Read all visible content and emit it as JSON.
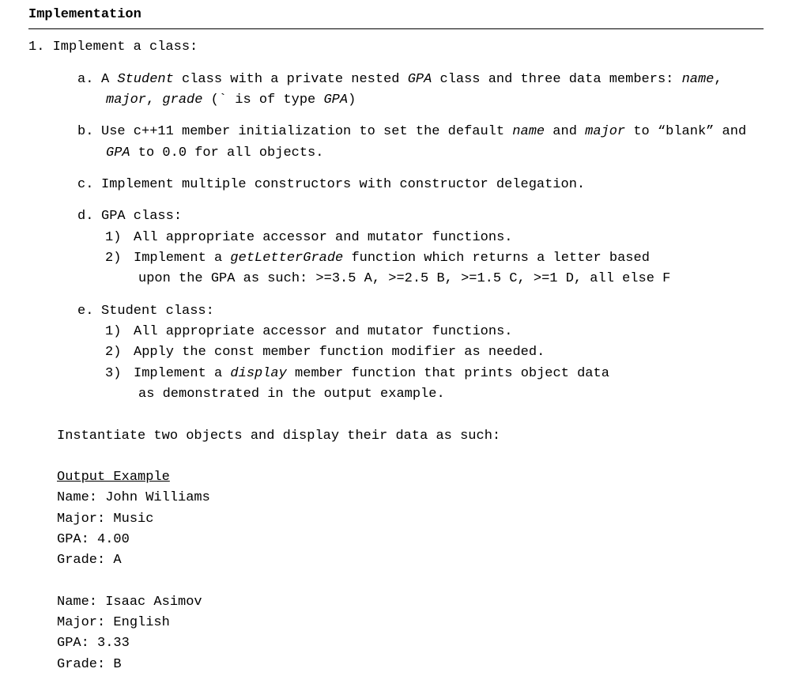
{
  "section_title": "Implementation",
  "main_item": {
    "number": "1.",
    "text": "Implement a class:"
  },
  "sub": {
    "a": {
      "mk": "a.",
      "pre": "A ",
      "student": "Student",
      "mid1": " class with a private nested ",
      "gpa": "GPA",
      "mid2": " class and three data members: ",
      "name": "name",
      "comma1": ", ",
      "major": "major",
      "comma2": ", ",
      "grade": "grade",
      "paren": " (` is of type ",
      "gpa2": "GPA",
      "close": ")"
    },
    "b": {
      "mk": "b.",
      "pre": "Use c++11 member initialization to set the default ",
      "name": "name",
      "and": " and ",
      "major": "major",
      "to": " to “blank” and ",
      "gpa": "GPA",
      "rest": " to 0.0 for all objects."
    },
    "c": {
      "mk": "c.",
      "text": "Implement multiple constructors with constructor delegation."
    },
    "d": {
      "mk": "d.",
      "text": "GPA class:",
      "i1": {
        "mk": "1)",
        "text": "All appropriate accessor and mutator functions."
      },
      "i2": {
        "mk": "2)",
        "pre": "Implement a ",
        "fn": "getLetterGrade",
        "mid": " function which returns a letter based",
        "hang": "upon the GPA as such: >=3.5 A, >=2.5 B, >=1.5 C, >=1 D, all else F"
      }
    },
    "e": {
      "mk": "e.",
      "text": "Student class:",
      "i1": {
        "mk": "1)",
        "text": "All appropriate accessor and mutator functions."
      },
      "i2": {
        "mk": "2)",
        "text": "Apply the const member function modifier as needed."
      },
      "i3": {
        "mk": "3)",
        "pre": "Implement a ",
        "fn": "display",
        "mid": " member function that prints object data",
        "hang": "as demonstrated in the output example."
      }
    }
  },
  "instantiate": "Instantiate two objects and display their data as such:",
  "output": {
    "title": "Output Example",
    "labels": {
      "name": "Name: ",
      "major": "Major: ",
      "gpa": "GPA: ",
      "grade": "Grade: "
    },
    "rec1": {
      "name": "John Williams",
      "major": "Music",
      "gpa": "4.00",
      "grade": "A"
    },
    "rec2": {
      "name": "Isaac Asimov",
      "major": "English",
      "gpa": "3.33",
      "grade": "B"
    }
  }
}
